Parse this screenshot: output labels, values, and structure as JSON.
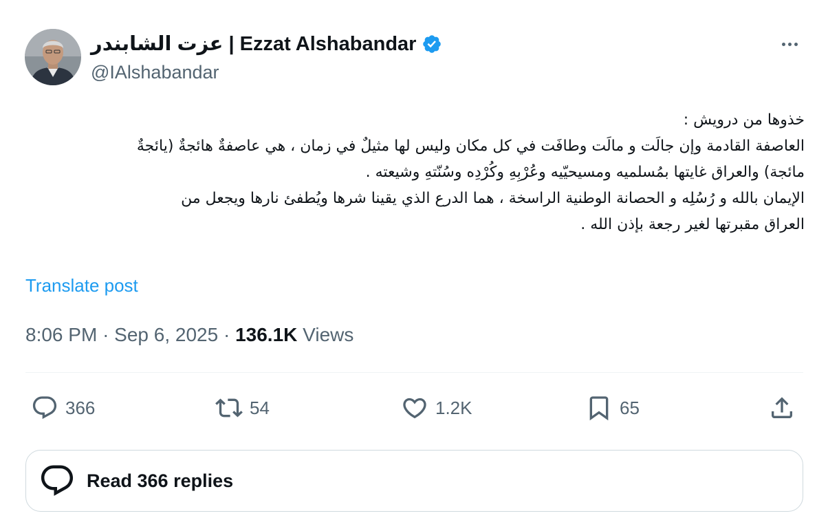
{
  "author": {
    "display_name": "عزت الشابندر | Ezzat Alshabandar",
    "handle": "@IAlshabandar",
    "verified_badge_icon": "verified-badge-icon",
    "verified_color": "#1d9bf0"
  },
  "post": {
    "text_lines": [
      "خذوها من  درويش :",
      "العاصفة القادمة وإن جالَت و مالَت وطافَت  في كل مكان وليس لها مثيلٌ في زمان ، هي عاصفةٌ هائجةٌ (يائجةٌ",
      "مائجة) والعراق غايتها بمُسلميه ومسيحيّيه وعُرْبِهِ وكُرْدِه وسُنّتهِ وشيعته .",
      "الإيمان بالله و رُسُلِه و الحصانة الوطنية الراسخة ، هما الدرع الذي يقينا شرها ويُطفئ نارها ويجعل من",
      "العراق مقبرتها لغير رجعة بإذن الله ."
    ],
    "translate_label": "Translate post",
    "time": "8:06 PM",
    "separator": "·",
    "date": "Sep 6, 2025",
    "views_count": "136.1K",
    "views_label": "Views"
  },
  "actions": {
    "replies": "366",
    "reposts": "54",
    "likes": "1.2K",
    "bookmarks": "65"
  },
  "read_replies_label": "Read 366 replies",
  "colors": {
    "accent": "#1d9bf0",
    "secondary_text": "#536471",
    "primary_text": "#0f1419",
    "border": "#cfd9de"
  }
}
